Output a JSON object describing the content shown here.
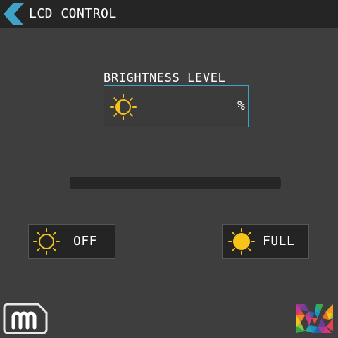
{
  "header": {
    "title": "LCD CONTROL",
    "back_icon": "chevron-left-icon"
  },
  "brightness": {
    "label": "BRIGHTNESS LEVEL",
    "value": "",
    "unit": "%",
    "icon": "half-sun-icon",
    "level": 0
  },
  "buttons": {
    "off": {
      "label": "OFF",
      "icon": "sun-outline-icon"
    },
    "full": {
      "label": "FULL",
      "icon": "sun-filled-icon"
    }
  },
  "colors": {
    "background": "#3e3e3e",
    "header": "#252525",
    "accent": "#3fa3c8",
    "sun": "#f7c318"
  }
}
